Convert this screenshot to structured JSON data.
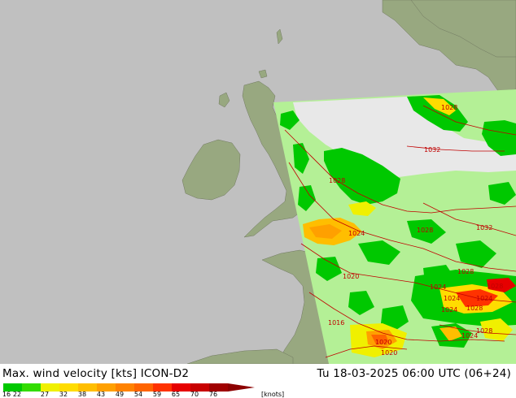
{
  "title_left": "Max. wind velocity [kts] ICON-D2",
  "title_right": "Tu 18-03-2025 06:00 UTC (06+24)",
  "legend": {
    "unit": "[knots]",
    "ticks": [
      "16",
      "22",
      "27",
      "32",
      "38",
      "43",
      "49",
      "54",
      "59",
      "65",
      "70",
      "76"
    ],
    "colors": [
      "#00c800",
      "#32dc00",
      "#f0f000",
      "#ffdc00",
      "#ffbe00",
      "#ffa000",
      "#ff8200",
      "#ff6400",
      "#ff3200",
      "#e60000",
      "#c80000",
      "#a00000",
      "#8c0000"
    ]
  },
  "isobars": [
    "1028",
    "1032",
    "1028",
    "1024",
    "1028",
    "1032",
    "1028",
    "1020",
    "1024",
    "1028",
    "1024",
    "1024",
    "1028",
    "1016",
    "1024",
    "1028",
    "1020",
    "1020",
    "1024"
  ],
  "colors": {
    "sea": "#c0c0c0",
    "land_outside": "#98a880",
    "domain_land": "#b4f096",
    "calm_area": "#e8e8e8",
    "isobar": "#c00000"
  }
}
